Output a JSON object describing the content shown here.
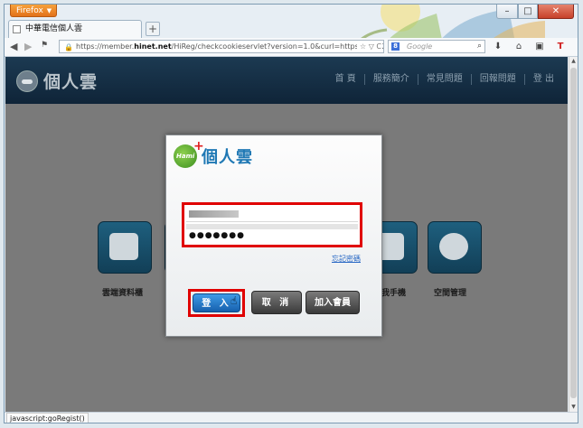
{
  "browser": {
    "app_button": "Firefox",
    "tab_title": "中華電信個人雲",
    "url_prefix": "https://member.",
    "url_domain": "hinet.net",
    "url_rest": "/HiReg/checkcookieservlet?version=1.0&curl=https%3A%2F",
    "search_placeholder": "Google",
    "status_text": "javascript:goRegist()"
  },
  "site": {
    "logo_text": "個人雲",
    "nav": [
      "首 頁",
      "服務簡介",
      "常見問題",
      "回報問題",
      "登 出"
    ],
    "tiles": [
      {
        "label": "雲端資料櫃"
      },
      {
        "label": "我手機"
      },
      {
        "label": "空間管理"
      }
    ]
  },
  "dialog": {
    "brand_badge": "Hami",
    "title": "個人雲",
    "password_mask": "●●●●●●●",
    "forgot_link": "忘記密碼",
    "login_button": "登 入",
    "cancel_button": "取 消",
    "join_button": "加入會員"
  },
  "colors": {
    "highlight": "#e00000",
    "brand_blue": "#1f78b4",
    "header_bg": "#0f2438"
  }
}
